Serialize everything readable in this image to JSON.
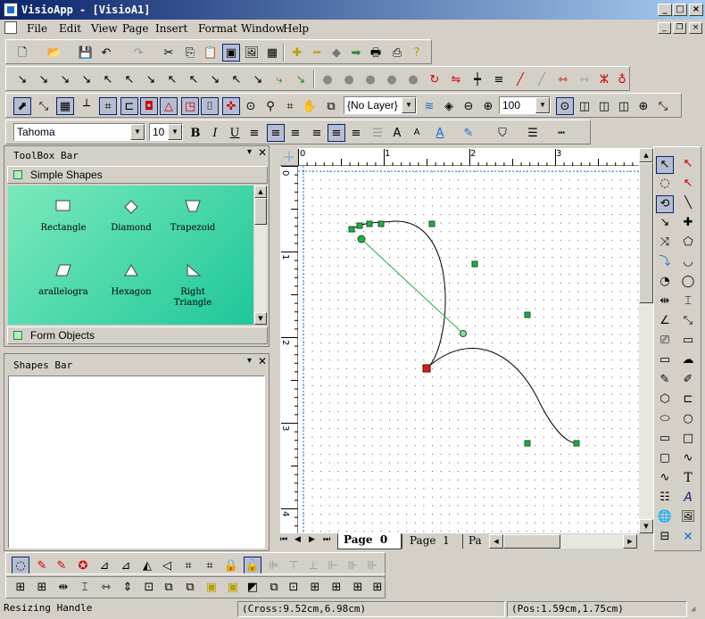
{
  "window": {
    "title": "VisioApp - [VisioA1]"
  },
  "menu": [
    "File",
    "Edit",
    "View",
    "Page",
    "Insert",
    "Format",
    "Window",
    "Help"
  ],
  "toolbar": {
    "layer_combo": "{No Layer}",
    "zoom_combo": "100",
    "font_combo": "Tahoma",
    "size_combo": "10"
  },
  "toolbox": {
    "title": "ToolBox Bar",
    "group_simple": "Simple Shapes",
    "group_form": "Form Objects",
    "shapes": [
      {
        "label": "Rectangle",
        "icon": "rectangle-icon"
      },
      {
        "label": "Diamond",
        "icon": "diamond-icon"
      },
      {
        "label": "Trapezoid",
        "icon": "trapezoid-icon"
      },
      {
        "label": "arallelogra",
        "icon": "parallelogram-icon"
      },
      {
        "label": "Hexagon",
        "icon": "hexagon-icon"
      },
      {
        "label": "Right Triangle",
        "icon": "right-triangle-icon"
      }
    ]
  },
  "shapes_bar": {
    "title": "Shapes Bar"
  },
  "ruler": {
    "h_labels": [
      "0",
      "1",
      "2",
      "3"
    ],
    "v_labels": [
      "0",
      "1",
      "2",
      "3",
      "4"
    ]
  },
  "tabs": [
    "Page  0",
    "Page  1",
    "Pa"
  ],
  "status": {
    "left": "Resizing Handle",
    "cross": "(Cross:9.52cm,6.98cm)",
    "pos": "(Pos:1.59cm,1.75cm)"
  },
  "colors": {
    "title_start": "#0a246a",
    "title_end": "#a6caf0",
    "panel_green_start": "#6ee6b0",
    "panel_green_end": "#1fc79a",
    "handle_green": "#2aa84a",
    "handle_red": "#d42020"
  }
}
